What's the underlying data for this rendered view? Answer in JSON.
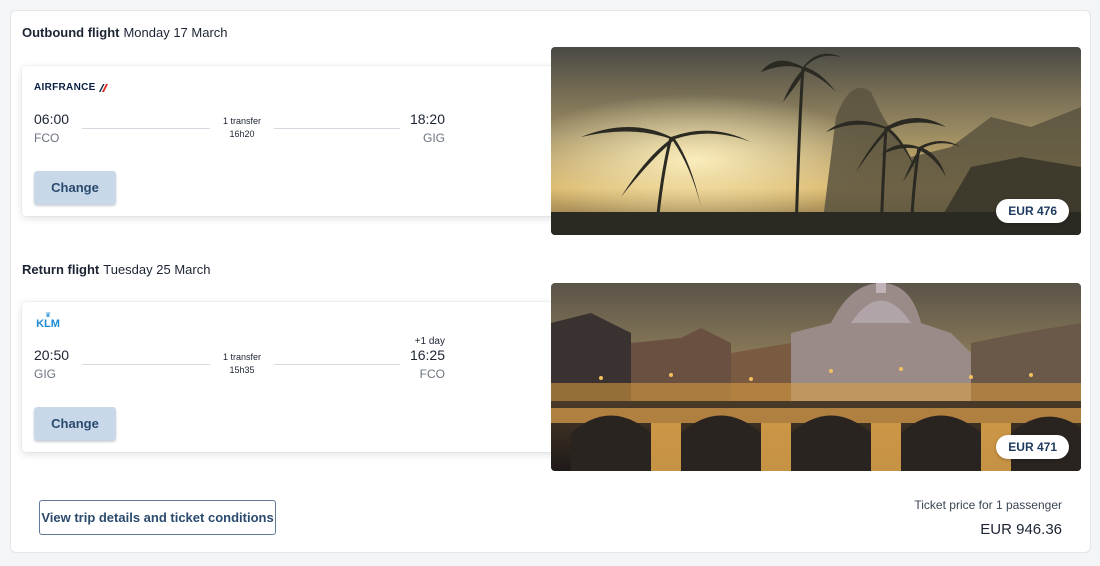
{
  "outbound": {
    "label": "Outbound flight",
    "date": "Monday 17 March",
    "airline": "AIRFRANCE",
    "dep_time": "06:00",
    "dep_code": "FCO",
    "transfer": "1 transfer",
    "duration": "16h20",
    "arr_time": "18:20",
    "arr_code": "GIG",
    "change_label": "Change",
    "price": "EUR 476"
  },
  "return": {
    "label": "Return flight",
    "date": "Tuesday 25 March",
    "airline": "KLM",
    "dep_time": "20:50",
    "dep_code": "GIG",
    "transfer": "1 transfer",
    "duration": "15h35",
    "day_offset": "+1 day",
    "arr_time": "16:25",
    "arr_code": "FCO",
    "change_label": "Change",
    "price": "EUR 471"
  },
  "footer": {
    "details_label": "View trip details and ticket conditions",
    "ticket_label": "Ticket price for 1 passenger",
    "total": "EUR 946.36"
  },
  "colors": {
    "accent": "#2a4a6e",
    "button_bg": "#c8d8e8",
    "airfrance_red": "#e3261b",
    "klm_blue": "#1e8ad6"
  }
}
